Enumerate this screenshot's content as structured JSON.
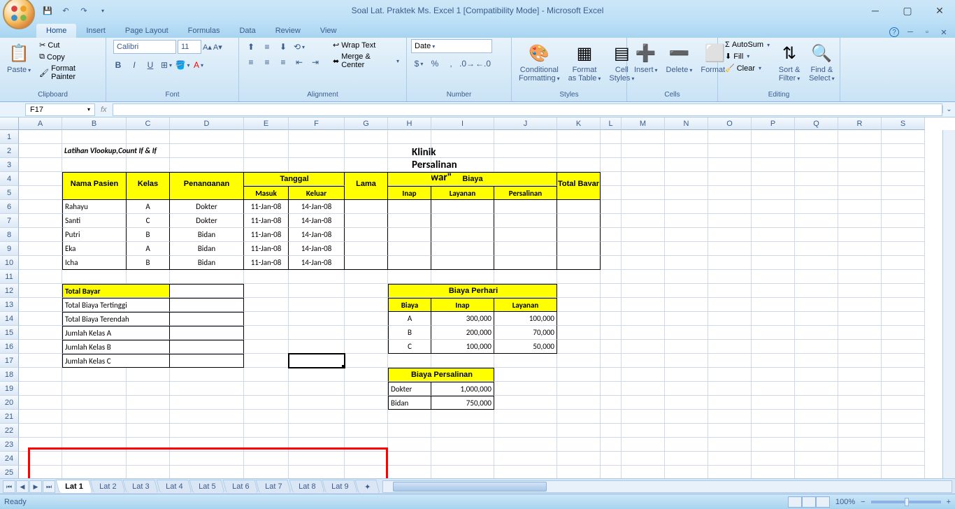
{
  "app": {
    "title": "Soal Lat. Praktek Ms. Excel 1  [Compatibility Mode] - Microsoft Excel",
    "active_cell": "F17",
    "status": "Ready",
    "zoom": "100%"
  },
  "ribbon": {
    "tabs": [
      "Home",
      "Insert",
      "Page Layout",
      "Formulas",
      "Data",
      "Review",
      "View"
    ],
    "active_tab": "Home",
    "clipboard": {
      "paste": "Paste",
      "cut": "Cut",
      "copy": "Copy",
      "painter": "Format Painter",
      "label": "Clipboard"
    },
    "font": {
      "name": "Calibri",
      "size": "11",
      "label": "Font"
    },
    "alignment": {
      "wrap": "Wrap Text",
      "merge": "Merge & Center",
      "label": "Alignment"
    },
    "number": {
      "format": "Date",
      "label": "Number"
    },
    "styles": {
      "cond": "Conditional\nFormatting",
      "table": "Format\nas Table",
      "cell": "Cell\nStyles",
      "label": "Styles"
    },
    "cells": {
      "insert": "Insert",
      "delete": "Delete",
      "format": "Format",
      "label": "Cells"
    },
    "editing": {
      "sum": "AutoSum",
      "fill": "Fill",
      "clear": "Clear",
      "sort": "Sort &\nFilter",
      "find": "Find &\nSelect",
      "label": "Editing"
    }
  },
  "sheets": [
    "Lat 1",
    "Lat 2",
    "Lat 3",
    "Lat 4",
    "Lat 5",
    "Lat 6",
    "Lat 7",
    "Lat 8",
    "Lat 9"
  ],
  "active_sheet": "Lat 1",
  "workbook": {
    "title_row": "Latihan Vlookup,Count If & If",
    "main_title": "Klinik Persalinan \"Mawar\"",
    "headers": {
      "nama": "Nama Pasien",
      "kelas": "Kelas",
      "pen": "Penanganan",
      "tanggal": "Tanggal",
      "masuk": "Masuk",
      "keluar": "Keluar",
      "lama": "Lama",
      "inap": "Inap",
      "biaya": "Biaya",
      "biaya_inap": "Inap",
      "layanan": "Layanan",
      "persalinan": "Persalinan",
      "total": "Total Bayar"
    },
    "patients": [
      {
        "nama": "Rahayu",
        "kelas": "A",
        "pen": "Dokter",
        "masuk": "11-Jan-08",
        "keluar": "14-Jan-08"
      },
      {
        "nama": "Santi",
        "kelas": "C",
        "pen": "Dokter",
        "masuk": "11-Jan-08",
        "keluar": "14-Jan-08"
      },
      {
        "nama": "Putri",
        "kelas": "B",
        "pen": "Bidan",
        "masuk": "11-Jan-08",
        "keluar": "14-Jan-08"
      },
      {
        "nama": "Eka",
        "kelas": "A",
        "pen": "Bidan",
        "masuk": "11-Jan-08",
        "keluar": "14-Jan-08"
      },
      {
        "nama": "Icha",
        "kelas": "B",
        "pen": "Bidan",
        "masuk": "11-Jan-08",
        "keluar": "14-Jan-08"
      }
    ],
    "summary": {
      "total_bayar": "Total Bayar",
      "tertinggi": "Total Biaya Tertinggi",
      "terendah": "Total Biaya Terendah",
      "kelasA": "Jumlah Kelas A",
      "kelasB": "Jumlah Kelas B",
      "kelasC": "Jumlah Kelas C"
    },
    "perhari": {
      "title": "Biaya Perhari",
      "h_biaya": "Biaya",
      "h_inap": "Inap",
      "h_layanan": "Layanan",
      "rows": [
        {
          "k": "A",
          "inap": "300,000",
          "lay": "100,000"
        },
        {
          "k": "B",
          "inap": "200,000",
          "lay": "70,000"
        },
        {
          "k": "C",
          "inap": "100,000",
          "lay": "50,000"
        }
      ]
    },
    "persalinan": {
      "title": "Biaya Persalinan",
      "rows": [
        {
          "k": "Dokter",
          "v": "1,000,000"
        },
        {
          "k": "Bidan",
          "v": "750,000"
        }
      ]
    }
  },
  "cols": [
    "A",
    "B",
    "C",
    "D",
    "E",
    "F",
    "G",
    "H",
    "I",
    "J",
    "K",
    "L",
    "M",
    "N",
    "O",
    "P",
    "Q",
    "R",
    "S"
  ]
}
